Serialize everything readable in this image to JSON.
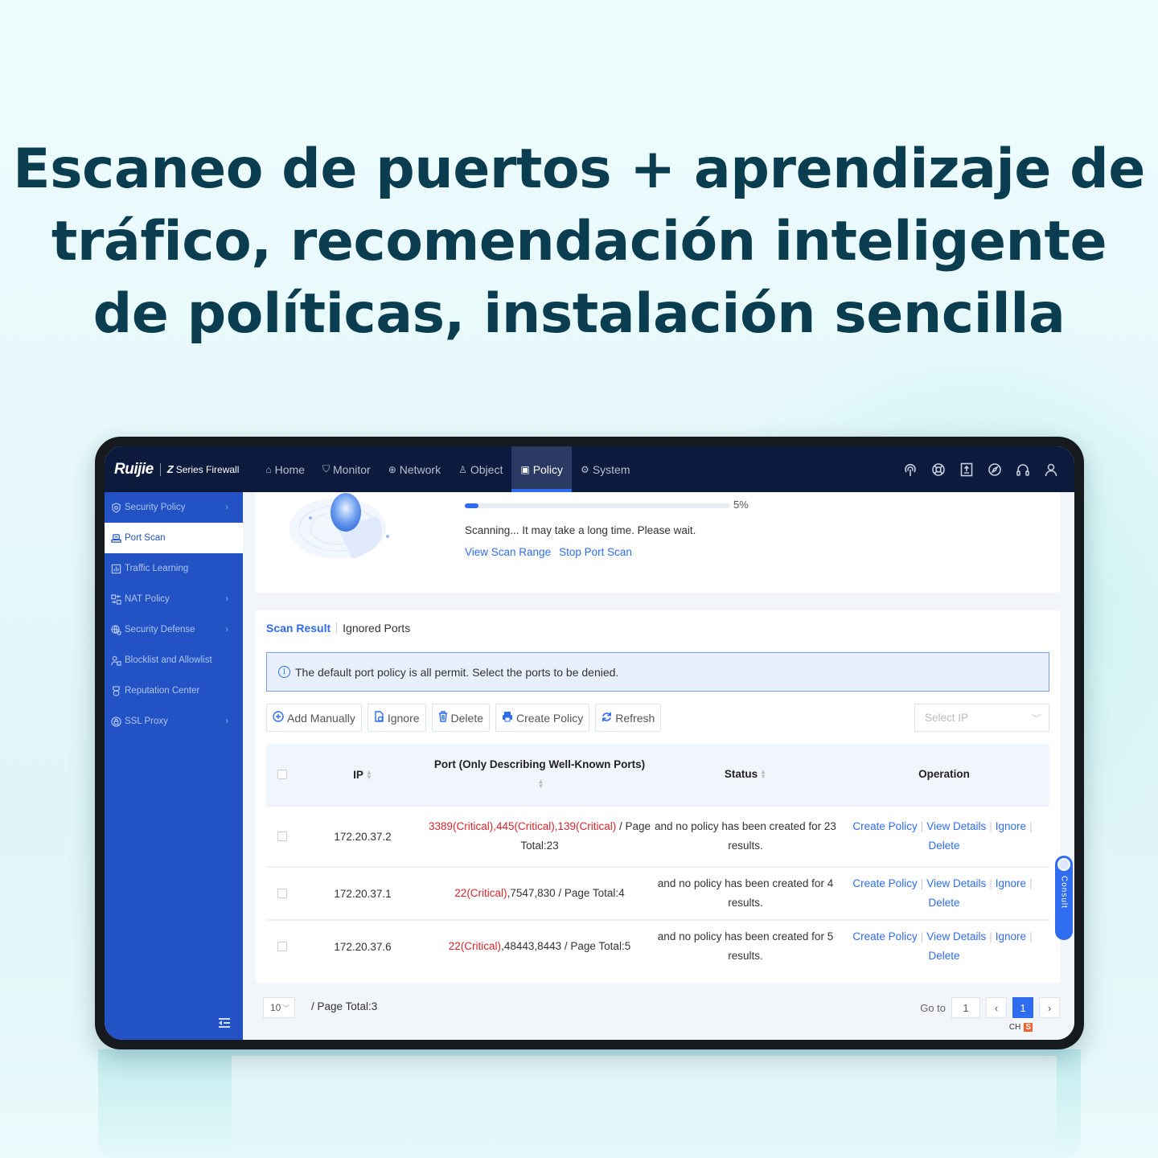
{
  "headline": {
    "lines": [
      "Escaneo de puertos + aprendizaje de",
      "tráfico, recomendación inteligente",
      "de políticas, instalación sencilla"
    ]
  },
  "app": {
    "logo": "Ruijie",
    "product_mark": "Z",
    "product_name": "Series Firewall"
  },
  "nav": {
    "items": [
      {
        "label": "Home",
        "icon": "home-icon"
      },
      {
        "label": "Monitor",
        "icon": "shield-icon"
      },
      {
        "label": "Network",
        "icon": "globe-icon"
      },
      {
        "label": "Object",
        "icon": "object-icon"
      },
      {
        "label": "Policy",
        "icon": "policy-icon",
        "active": true
      },
      {
        "label": "System",
        "icon": "gear-icon"
      }
    ],
    "right_icons": [
      "signal-icon",
      "help-ring-icon",
      "upload-icon",
      "compass-icon",
      "headset-icon",
      "user-icon"
    ]
  },
  "sidebar": {
    "items": [
      {
        "label": "Security Policy",
        "icon": "security-policy-icon",
        "has_children": true
      },
      {
        "label": "Port Scan",
        "icon": "port-scan-icon",
        "active": true
      },
      {
        "label": "Traffic Learning",
        "icon": "traffic-learning-icon"
      },
      {
        "label": "NAT Policy",
        "icon": "nat-icon",
        "has_children": true
      },
      {
        "label": "Security Defense",
        "icon": "security-defense-icon",
        "has_children": true
      },
      {
        "label": "Blocklist and Allowlist",
        "icon": "blocklist-icon"
      },
      {
        "label": "Reputation Center",
        "icon": "reputation-icon"
      },
      {
        "label": "SSL Proxy",
        "icon": "ssl-proxy-icon",
        "has_children": true
      }
    ]
  },
  "scan": {
    "progress_percent": 5,
    "progress_label": "5%",
    "message": "Scanning... It may take a long time. Please wait.",
    "view_range_link": "View Scan Range",
    "stop_link": "Stop Port Scan"
  },
  "result": {
    "tabs": [
      {
        "label": "Scan Result",
        "active": true
      },
      {
        "label": "Ignored Ports"
      }
    ],
    "alert": "The default port policy is all permit. Select the ports to be denied.",
    "toolbar": {
      "add": "Add Manually",
      "ignore": "Ignore",
      "delete": "Delete",
      "create_policy": "Create Policy",
      "refresh": "Refresh"
    },
    "select_ip_placeholder": "Select IP",
    "table": {
      "headers": {
        "ip": "IP",
        "port": "Port (Only Describing Well-Known Ports)",
        "status": "Status",
        "operation": "Operation"
      },
      "rows": [
        {
          "ip": "172.20.37.2",
          "critical": "3389(Critical),445(Critical),139(Critical)",
          "rest": " / Page Total:23",
          "status": "and no policy has been created for 23 results."
        },
        {
          "ip": "172.20.37.1",
          "critical": "22(Critical)",
          "rest": ",7547,830 / Page Total:4",
          "status": "and no policy has been created for 4 results."
        },
        {
          "ip": "172.20.37.6",
          "critical": "22(Critical)",
          "rest": ",48443,8443 / Page Total:5",
          "status": "and no policy has been created for 5 results."
        }
      ],
      "row_ops": {
        "create": "Create Policy",
        "view": "View Details",
        "ignore": "Ignore",
        "delete": "Delete"
      }
    }
  },
  "pagination": {
    "page_size": "10",
    "total": "/ Page Total:3",
    "goto_label": "Go to",
    "goto_value": "1",
    "current_page": "1"
  },
  "consult": {
    "label": "Consult"
  },
  "ime": {
    "lang": "CH",
    "badge": "S"
  },
  "colors": {
    "nav_bg": "#0c1a3e",
    "sidebar_bg": "#2252c4",
    "accent": "#2f6cf0",
    "critical": "#d9262c",
    "headline": "#0a3d50"
  }
}
